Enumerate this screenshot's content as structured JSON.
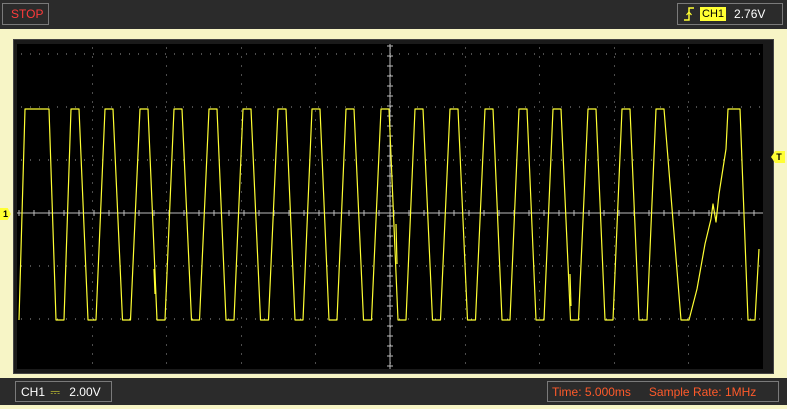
{
  "status": {
    "label": "STOP",
    "color": "#ff3b3b"
  },
  "trigger": {
    "edge_icon": "rising-edge-icon",
    "channel": "CH1",
    "level": "2.76V"
  },
  "channel_info": {
    "name": "CH1",
    "coupling_icon": "dc-coupling-icon",
    "coupling_symbol": "⎓",
    "scale": "2.00V"
  },
  "timebase": {
    "time": "Time: 5.000ms",
    "sample_rate": "Sample Rate: 1MHz"
  },
  "markers": {
    "channel": "1",
    "trigger": "T"
  },
  "colors": {
    "trace": "#ffff33",
    "grid": "#9a9a9a",
    "screen": "#000000",
    "panel": "#2b2b2b",
    "background": "#f7f5c6"
  }
}
